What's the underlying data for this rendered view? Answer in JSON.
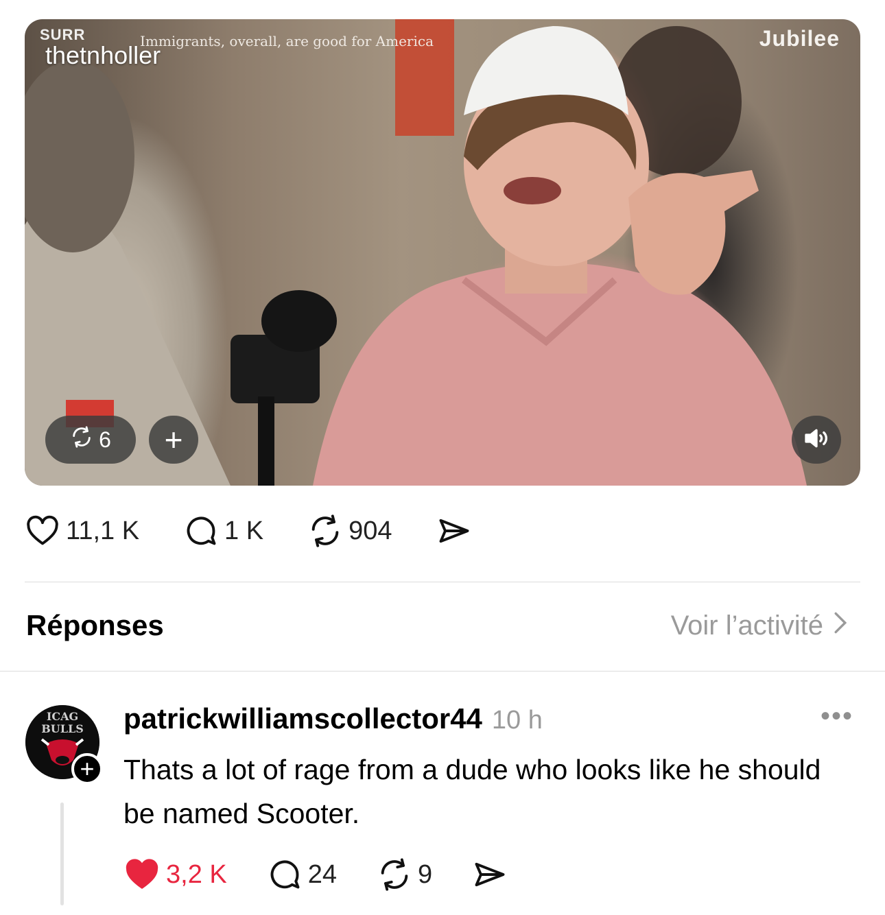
{
  "video": {
    "overlay_brand_left": "SURR",
    "overlay_username": "thetnholler",
    "overlay_caption": "Immigrants, overall, are good for America",
    "overlay_brand_right": "Jubilee",
    "repost_count": "6",
    "add_label": "+"
  },
  "post_actions": {
    "likes": "11,1 K",
    "comments": "1 K",
    "reposts": "904"
  },
  "replies_section": {
    "title": "Réponses",
    "activity_link": "Voir l’activité"
  },
  "reply": {
    "username": "patrickwilliamscollector44",
    "time": "10 h",
    "more": "•••",
    "text": "Thats a lot of rage from a dude who looks like he should be named Scooter.",
    "follow_label": "+",
    "likes": "3,2 K",
    "comments": "24",
    "reposts": "9",
    "liked": true,
    "avatar_text_top": "ICAG",
    "avatar_text_mid": "BULLS"
  },
  "colors": {
    "like_red": "#e8253f",
    "muted_gray": "#9a9a9a",
    "divider": "#dcdcdc"
  }
}
